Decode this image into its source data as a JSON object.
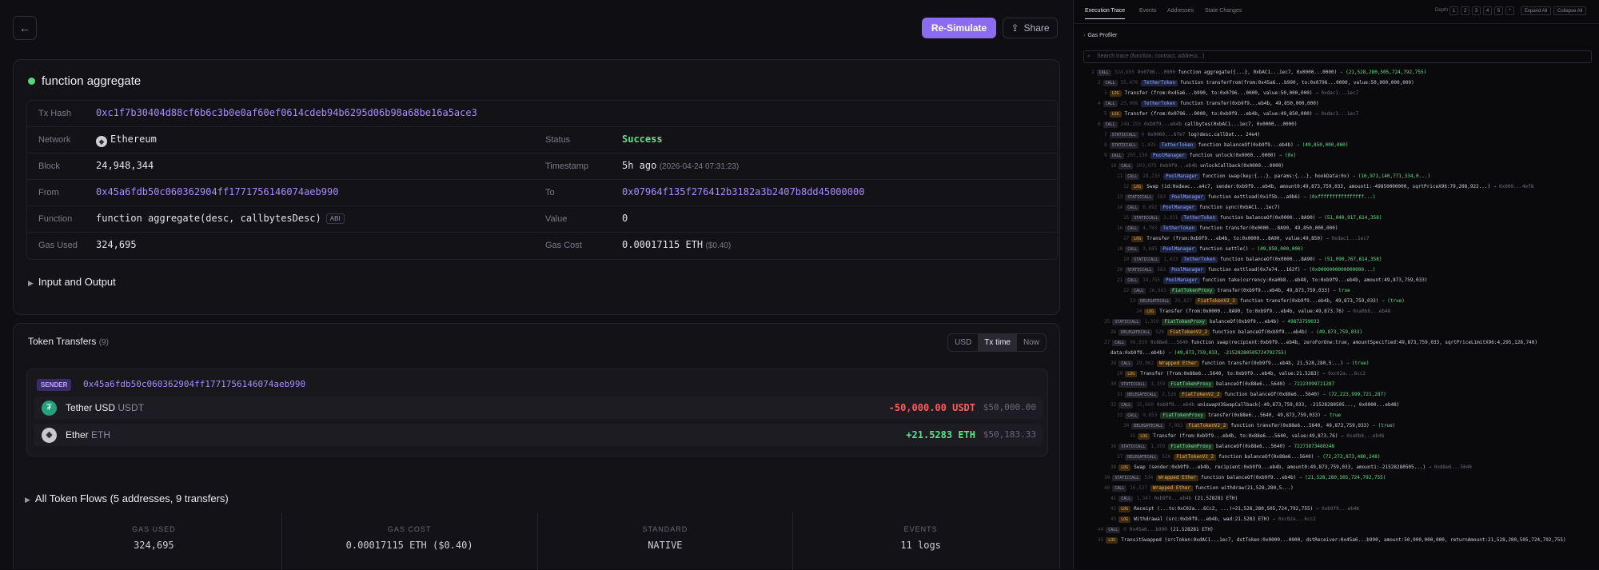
{
  "header": {
    "resimulate_label": "Re-Simulate",
    "share_label": "Share"
  },
  "summary": {
    "function_title": "function aggregate",
    "fields": {
      "tx_hash_label": "Tx Hash",
      "tx_hash": "0xc1f7b30404d88cf6b6c3b0e0af60ef0614cdeb94b6295d06b98a68be16a5ace3",
      "network_label": "Network",
      "network": "Ethereum",
      "status_label": "Status",
      "status": "Success",
      "block_label": "Block",
      "block": "24,948,344",
      "timestamp_label": "Timestamp",
      "timestamp": "5h ago",
      "timestamp_full": "(2026-04-24 07:31:23)",
      "from_label": "From",
      "from": "0x45a6fdb50c060362904ff1771756146074aeb990",
      "to_label": "To",
      "to": "0x07964f135f276412b3182a3b2407b8dd45000000",
      "function_label": "Function",
      "function_sig": "function aggregate(desc, callbytesDesc)",
      "abi_badge": "ABI",
      "value_label": "Value",
      "value": "0",
      "gas_used_label": "Gas Used",
      "gas_used": "324,695",
      "gas_cost_label": "Gas Cost",
      "gas_cost": "0.00017115 ETH",
      "gas_cost_usd": "($0.40)"
    },
    "input_output_label": "Input and Output"
  },
  "transfers": {
    "title": "Token Transfers",
    "count": "(9)",
    "toggle": [
      "USD",
      "Tx time",
      "Now"
    ],
    "sender_tag": "SENDER",
    "sender_address": "0x45a6fdb50c060362904ff1771756146074aeb990",
    "tokens": [
      {
        "name": "Tether USD",
        "symbol": "USDT",
        "amount": "-50,000.00 USDT",
        "usd": "$50,000.00",
        "color": "#ff5c5c",
        "icon_color": "#26a17b",
        "icon": "₮"
      },
      {
        "name": "Ether",
        "symbol": "ETH",
        "amount": "+21.5283 ETH",
        "usd": "$50,183.33",
        "color": "#5ee08a",
        "icon_color": "#c9c9cf",
        "icon": "◆"
      }
    ],
    "all_flows_label": "All Token Flows (5 addresses, 9 transfers)",
    "stats": [
      {
        "label": "GAS USED",
        "value": "324,695"
      },
      {
        "label": "GAS COST",
        "value": "0.00017115 ETH ($0.40)"
      },
      {
        "label": "STANDARD",
        "value": "NATIVE"
      },
      {
        "label": "EVENTS",
        "value": "11 logs"
      }
    ]
  },
  "trace_panel": {
    "tabs": [
      "Execution Trace",
      "Events",
      "Addresses",
      "State Changes"
    ],
    "depth_label": "Depth",
    "depth_buttons": [
      "1",
      "2",
      "3",
      "4",
      "5",
      "*"
    ],
    "expand_all": "Expand All",
    "collapse_all": "Collapse All",
    "gas_profiler": "Gas Profiler",
    "search_placeholder": "Search trace (function, contract, address...)",
    "lines": [
      {
        "d": 0,
        "n": "1",
        "op": "CALL",
        "gas": "324,695",
        "ct": "",
        "pre": "0x0796...0000",
        "fn": "function aggregate({...}, 0xbAC1...1ec7, 0x0000...0000)",
        "ret": "(21,528,280,505,724,792,755)"
      },
      {
        "d": 1,
        "n": "2",
        "op": "CALL",
        "gas": "35,470",
        "ct": "TetherToken",
        "fn": "function transferFrom(from:0x45a6...b990, to:0x0796...0000, value:50,000,000,000)",
        "ret": ""
      },
      {
        "d": 2,
        "n": "3",
        "op": "LOG",
        "gas": "",
        "ct": "",
        "ev": true,
        "fn": "Transfer (from:0x45a6...b990, to:0x0796...0000, value:50,000,000)",
        "ret": "0xdac1...1ec7"
      },
      {
        "d": 1,
        "n": "4",
        "op": "CALL",
        "gas": "25,908",
        "ct": "TetherToken",
        "fn": "function transfer(0xb9f9...eb4b, 49,850,000,000)",
        "ret": ""
      },
      {
        "d": 2,
        "n": "5",
        "op": "LOG",
        "gas": "",
        "ct": "",
        "ev": true,
        "fn": "Transfer (from:0x0796...0000, to:0xb9f9...eb4b, value:49,850,000)",
        "ret": "0xdac1...1ec7"
      },
      {
        "d": 1,
        "n": "6",
        "op": "CALL",
        "gas": "248,155",
        "ct": "",
        "pre": "0xb9f9...eb4b",
        "fn": "callbytes(0xbAC1...1ec7, 0x0000...0000)",
        "ret": ""
      },
      {
        "d": 2,
        "n": "7",
        "op": "STATICCALL",
        "gas": "0",
        "ct": "",
        "pre": "0x0000...6fe7",
        "fn": "log(desc.callDat... 24e4)",
        "ret": ""
      },
      {
        "d": 2,
        "n": "8",
        "op": "STATICCALL",
        "gas": "1,433",
        "ct": "TetherToken",
        "fn": "function balanceOf(0xb9f9...eb4b)",
        "ret": "(49,850,000,000)"
      },
      {
        "d": 2,
        "n": "9",
        "op": "CALL",
        "gas": "205,130",
        "ct": "PoolManager",
        "fn": "function unlock(0x0000...0000)",
        "ret": "(0x)"
      },
      {
        "d": 3,
        "n": "10",
        "op": "CALL",
        "gas": "203,075",
        "ct": "",
        "pre": "0xb9f9...eb4b",
        "fn": "unlockCallback(0x0000...0000)",
        "ret": ""
      },
      {
        "d": 4,
        "n": "11",
        "op": "CALL",
        "gas": "28,233",
        "ct": "PoolManager",
        "fn": "function swap(key:{...}, params:{...}, hookData:0x)",
        "ret": "(16,971,140,771,334,0...)"
      },
      {
        "d": 5,
        "n": "12",
        "op": "LOG",
        "gas": "",
        "ct": "",
        "ev": true,
        "fn": "Swap (id:0xdeac...a4c7, sender:0xb9f9...eb4b, amount0:49,873,759,033, amount1:-49850000000, sqrtPriceX96:79,208,922...)",
        "ret": "0x000...4ef8"
      },
      {
        "d": 4,
        "n": "13",
        "op": "STATICCALL",
        "gas": "583",
        "ct": "PoolManager",
        "fn": "function exttload(0x1f5b...a9b6)",
        "ret": "(0xffffffffffffffff...)"
      },
      {
        "d": 4,
        "n": "14",
        "op": "CALL",
        "gas": "6,892",
        "ct": "PoolManager",
        "fn": "function sync(0xbAC1...1ec7)",
        "ret": ""
      },
      {
        "d": 5,
        "n": "15",
        "op": "STATICCALL",
        "gas": "2,931",
        "ct": "TetherToken",
        "fn": "function balanceOf(0x0000...8A90)",
        "ret": "(51,040,917,614,358)"
      },
      {
        "d": 4,
        "n": "16",
        "op": "CALL",
        "gas": "4,763",
        "ct": "TetherToken",
        "fn": "function transfer(0x0000...8A90, 49,850,000,000)",
        "ret": ""
      },
      {
        "d": 5,
        "n": "17",
        "op": "LOG",
        "gas": "",
        "ct": "",
        "ev": true,
        "fn": "Transfer (from:0xb9f9...eb4b, to:0x0000...8A90, value:49,850)",
        "ret": "0xdac1...1ec7"
      },
      {
        "d": 4,
        "n": "18",
        "op": "CALL",
        "gas": "3,885",
        "ct": "PoolManager",
        "fn": "function settle()",
        "ret": "(49,850,000,000)"
      },
      {
        "d": 5,
        "n": "19",
        "op": "STATICCALL",
        "gas": "1,433",
        "ct": "TetherToken",
        "fn": "function balanceOf(0x0000...8A90)",
        "ret": "(51,090,767,614,358)"
      },
      {
        "d": 4,
        "n": "20",
        "op": "STATICCALL",
        "gas": "583",
        "ct": "PoolManager",
        "fn": "function exttload(0x7e74...162f)",
        "ret": "(0x0000000000000000...)"
      },
      {
        "d": 4,
        "n": "21",
        "op": "CALL",
        "gas": "34,755",
        "ct": "PoolManager",
        "fn": "function take(currency:0xa0b8...eb48, to:0xb9f9...eb4b, amount:49,873,759,033)",
        "ret": ""
      },
      {
        "d": 5,
        "n": "22",
        "op": "CALL",
        "gas": "26,663",
        "ct": "FiatTokenProxy",
        "g": true,
        "fn": "transfer(0xb9f9...eb4b, 49,873,759,033)",
        "ret": "true"
      },
      {
        "d": 6,
        "n": "23",
        "op": "DELEGATECALL",
        "gas": "25,827",
        "ct": "FiatTokenV2_2",
        "o": true,
        "fn": "function transfer(0xb9f9...eb4b, 49,873,759,033)",
        "ret": "(true)"
      },
      {
        "d": 7,
        "n": "24",
        "op": "LOG",
        "gas": "",
        "ct": "",
        "ev": true,
        "fn": "Transfer (from:0x0000...8A90, to:0xb9f9...eb4b, value:49,873.76)",
        "ret": "0xa0b8...eb48"
      },
      {
        "d": 2,
        "n": "25",
        "op": "STATICCALL",
        "gas": "1,359",
        "ct": "FiatTokenProxy",
        "g": true,
        "fn": "balanceOf(0xb9f9...eb4b)",
        "ret": "49873759033"
      },
      {
        "d": 3,
        "n": "26",
        "op": "DELEGATECALL",
        "gas": "526",
        "ct": "FiatTokenV2_2",
        "o": true,
        "fn": "function balanceOf(0xb9f9...eb4b)",
        "ret": "(49,873,759,033)"
      },
      {
        "d": 2,
        "n": "27",
        "op": "CALL",
        "gas": "96,939",
        "ct": "",
        "pre": "0x88e6...5640",
        "fn": "function swap(recipient:0xb9f9...eb4b, zeroForOne:true, amountSpecified:49,873,759,033, sqrtPriceLimitX96:4,295,128,740)",
        "ret": ""
      },
      {
        "d": 3,
        "n": "",
        "op": "",
        "gas": "",
        "ct": "",
        "fn": "data:0xb9f9...eb4b)",
        "ret": "(49,873,759,033, -21528280505724792755)"
      },
      {
        "d": 3,
        "n": "28",
        "op": "CALL",
        "gas": "29,962",
        "ct": "Wrapped Ether",
        "o": true,
        "fn": "function transfer(0xb9f9...eb4b, 21,528,280,5...)",
        "ret": "(true)"
      },
      {
        "d": 4,
        "n": "29",
        "op": "LOG",
        "gas": "",
        "ct": "",
        "ev": true,
        "fn": "Transfer (from:0x88e6...5640, to:0xb9f9...eb4b, value:21.5283)",
        "ret": "0xc02a...6cc2"
      },
      {
        "d": 3,
        "n": "30",
        "op": "STATICCALL",
        "gas": "3,359",
        "ct": "FiatTokenProxy",
        "g": true,
        "fn": "balanceOf(0x88e6...5640)",
        "ret": "72223999721287"
      },
      {
        "d": 4,
        "n": "31",
        "op": "DELEGATECALL",
        "gas": "2,526",
        "ct": "FiatTokenV2_2",
        "o": true,
        "fn": "function balanceOf(0x88e6...5640)",
        "ret": "(72,223,999,721,287)"
      },
      {
        "d": 3,
        "n": "32",
        "op": "CALL",
        "gas": "15,060",
        "ct": "",
        "pre": "0xb9f9...eb4b",
        "fn": "uniswapV3SwapCallback(-49,873,759,033, -21528280505..., 0x0000...eb48)",
        "ret": ""
      },
      {
        "d": 4,
        "n": "33",
        "op": "CALL",
        "gas": "9,853",
        "ct": "FiatTokenProxy",
        "g": true,
        "fn": "transfer(0x88e6...5640, 49,873,759,033)",
        "ret": "true"
      },
      {
        "d": 5,
        "n": "34",
        "op": "DELEGATECALL",
        "gas": "7,983",
        "ct": "FiatTokenV2_2",
        "o": true,
        "fn": "function transfer(0x88e6...5640, 49,873,759,033)",
        "ret": "(true)"
      },
      {
        "d": 6,
        "n": "35",
        "op": "LOG",
        "gas": "",
        "ct": "",
        "ev": true,
        "fn": "Transfer (from:0xb9f9...eb4b, to:0x88e6...5640, value:49,873.76)",
        "ret": "0xa0b8...eb48"
      },
      {
        "d": 3,
        "n": "36",
        "op": "STATICCALL",
        "gas": "1,359",
        "ct": "FiatTokenProxy",
        "g": true,
        "fn": "balanceOf(0x88e6...5640)",
        "ret": "72273873480248"
      },
      {
        "d": 4,
        "n": "37",
        "op": "DELEGATECALL",
        "gas": "526",
        "ct": "FiatTokenV2_2",
        "o": true,
        "fn": "function balanceOf(0x88e6...5640)",
        "ret": "(72,273,873,480,248)"
      },
      {
        "d": 3,
        "n": "38",
        "op": "LOG",
        "gas": "",
        "ct": "",
        "ev": true,
        "fn": "Swap (sender:0xb9f9...eb4b, recipient:0xb9f9...eb4b, amount0:49,873,759,033, amount1:-21528280505...)",
        "ret": "0x88e6...5640"
      },
      {
        "d": 2,
        "n": "39",
        "op": "STATICCALL",
        "gas": "534",
        "ct": "Wrapped Ether",
        "o": true,
        "fn": "function balanceOf(0xb9f9...eb4b)",
        "ret": "(21,528,280,505,724,792,755)"
      },
      {
        "d": 2,
        "n": "40",
        "op": "CALL",
        "gas": "16,537",
        "ct": "Wrapped Ether",
        "o": true,
        "fn": "function withdraw(21,528,280,5...)",
        "ret": ""
      },
      {
        "d": 3,
        "n": "41",
        "op": "CALL",
        "gas": "1,347",
        "ct": "",
        "pre": "0xb9f9...eb4b",
        "fn": "(21.528281 ETH)",
        "ret": ""
      },
      {
        "d": 3,
        "n": "42",
        "op": "LOG",
        "gas": "",
        "ct": "",
        "ev": true,
        "fn": "Receipt (...to:0xC02a...6Cc2, ...)=21,528,280,505,724,792,755)",
        "ret": "0xb9f9...eb4b"
      },
      {
        "d": 3,
        "n": "43",
        "op": "LOG",
        "gas": "",
        "ct": "",
        "ev": true,
        "fn": "Withdrawal (src:0xb9f9...eb4b, wad:21.5283 ETH)",
        "ret": "0xc02a...6cc2"
      },
      {
        "d": 1,
        "n": "44",
        "op": "CALL",
        "gas": "0",
        "ct": "",
        "pre": "0x45a6...b990",
        "fn": "(21.528281 ETH)",
        "ret": ""
      },
      {
        "d": 1,
        "n": "45",
        "op": "LOG",
        "gas": "",
        "ct": "",
        "ev": true,
        "fn": "TransitSwapped (srcToken:0xdAC1...1ec7, dstToken:0x0000...0000, dstReceiver:0x45a6...b990, amount:50,000,000,000, returnAmount:21,528,280,505,724,792,755)",
        "ret": ""
      }
    ]
  }
}
